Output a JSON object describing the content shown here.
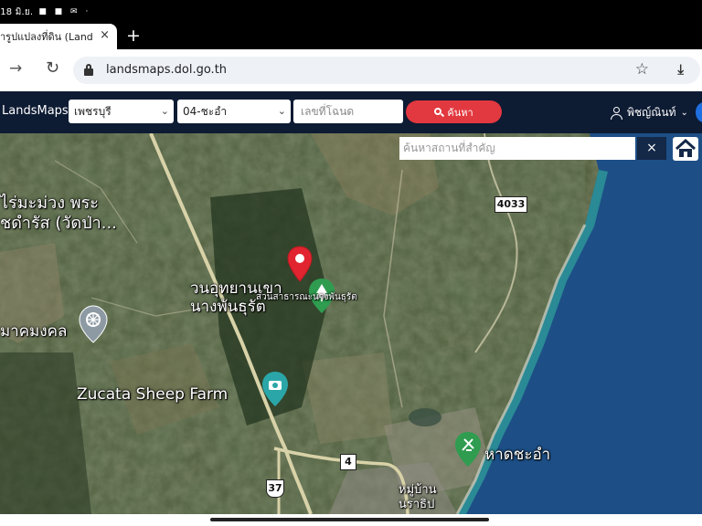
{
  "status_bar": {
    "time": "ี18 มิ.ย.",
    "icons": [
      "photo-icon",
      "facebook-icon",
      "mail-icon",
      "dot"
    ]
  },
  "browser": {
    "tab": {
      "title": "ารูปแปลงที่ดิน (Land",
      "close": "×"
    },
    "new_tab": "+",
    "url": "landsmaps.dol.go.th"
  },
  "app": {
    "brand": "LandsMaps",
    "province": "เพชรบุรี",
    "district": "04-ชะอำ",
    "deed_placeholder": "เลขที่โฉนด",
    "search_label": "ค้นหา",
    "user_name": "พิชญ์ณินท์"
  },
  "map": {
    "poi_search_placeholder": "ค้นหาสถานที่สำคัญ",
    "poi_close": "×",
    "labels": {
      "temple": "ไร่มะม่วง พระ\nชดำรัส (วัดป่า...",
      "park": "วนอุทยานเขา\nนางพันธุรัต",
      "park_small": "สวนสาธารณะนางพันธุรัต",
      "mangala": "มาคมงคล",
      "farm": "Zucata Sheep Farm",
      "beach": "หาดชะอำ",
      "village": "หมู่บ้าน\nนราธิป"
    },
    "road_shields": {
      "r4033": "4033",
      "r4": "4",
      "r37": "37"
    },
    "colors": {
      "sea": "#1d4f86",
      "land": "#4c5a38",
      "forest": "#2c4026",
      "pin": "#e1242f",
      "poi_green": "#2f9c50",
      "poi_teal": "#2aa6a8",
      "poi_gray": "#8e9aa3"
    }
  }
}
